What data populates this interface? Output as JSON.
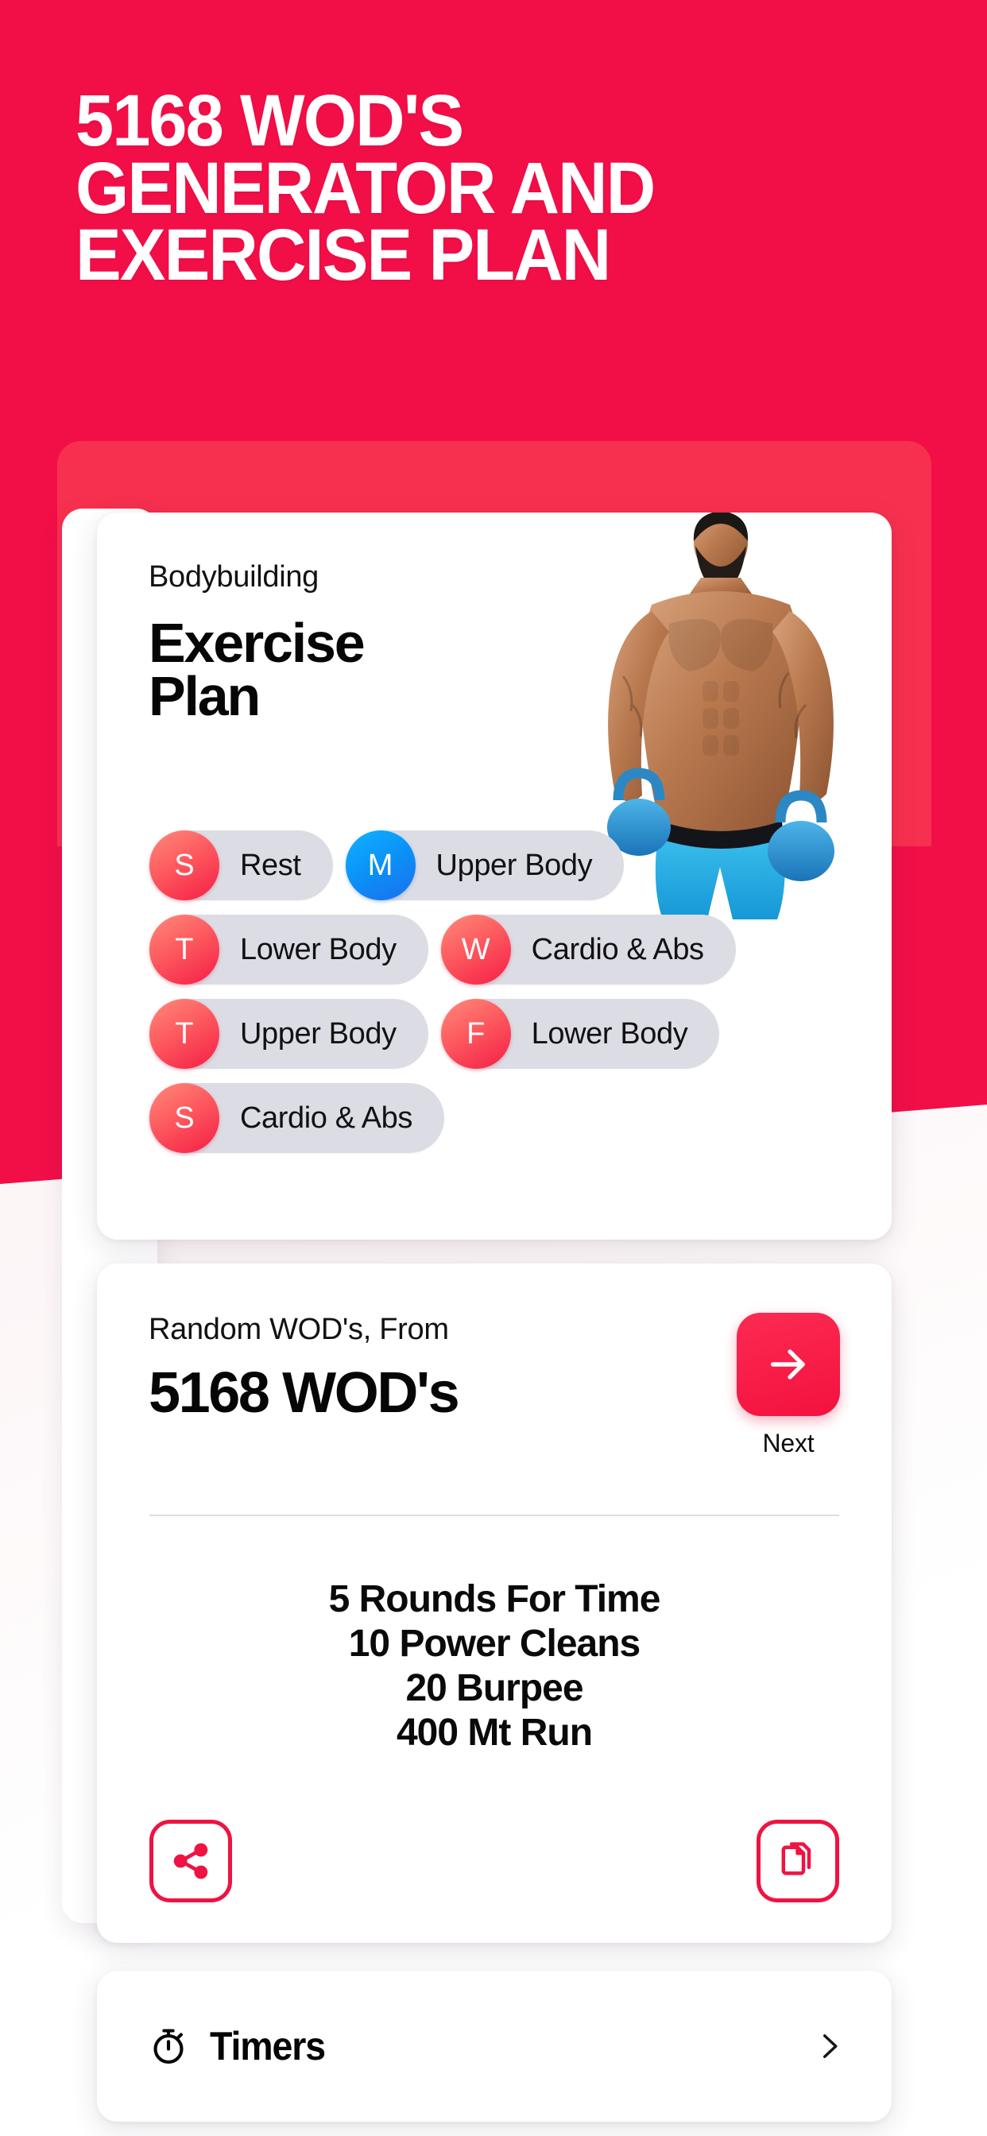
{
  "theme": {
    "brand_red": "#f20f48",
    "brand_red_soft": "#f8304f",
    "accent_blue": "#0b92f7",
    "pill_grey": "#dcdce4",
    "card_white": "#ffffff",
    "text_dark": "#0a0a0a"
  },
  "hero": {
    "line1": "5168 WOD'S",
    "line2": "GENERATOR AND",
    "line3": "EXERCISE PLAN"
  },
  "plan_card": {
    "kicker": "Bodybuilding",
    "title_line1": "Exercise",
    "title_line2": "Plan",
    "athlete_image_alt": "bodybuilder-holding-kettlebells",
    "days": [
      {
        "initial": "S",
        "label": "Rest",
        "today": false
      },
      {
        "initial": "M",
        "label": "Upper Body",
        "today": true
      },
      {
        "initial": "T",
        "label": "Lower Body",
        "today": false
      },
      {
        "initial": "W",
        "label": "Cardio & Abs",
        "today": false
      },
      {
        "initial": "T",
        "label": "Upper Body",
        "today": false
      },
      {
        "initial": "F",
        "label": "Lower Body",
        "today": false
      },
      {
        "initial": "S",
        "label": "Cardio & Abs",
        "today": false
      }
    ],
    "day_rows": [
      [
        0,
        1
      ],
      [
        2,
        3
      ],
      [
        4,
        5
      ],
      [
        6
      ]
    ]
  },
  "wod_card": {
    "kicker": "Random WOD's, From",
    "count": "5168 WOD's",
    "next_label": "Next",
    "next_icon": "arrow-right-icon",
    "workout_lines": [
      "5 Rounds For Time",
      "10 Power Cleans",
      "20 Burpee",
      "400 Mt Run"
    ],
    "share_icon": "share-icon",
    "copy_icon": "copy-icon"
  },
  "timers_row": {
    "icon": "stopwatch-icon",
    "label": "Timers",
    "chevron": "chevron-right-icon"
  }
}
